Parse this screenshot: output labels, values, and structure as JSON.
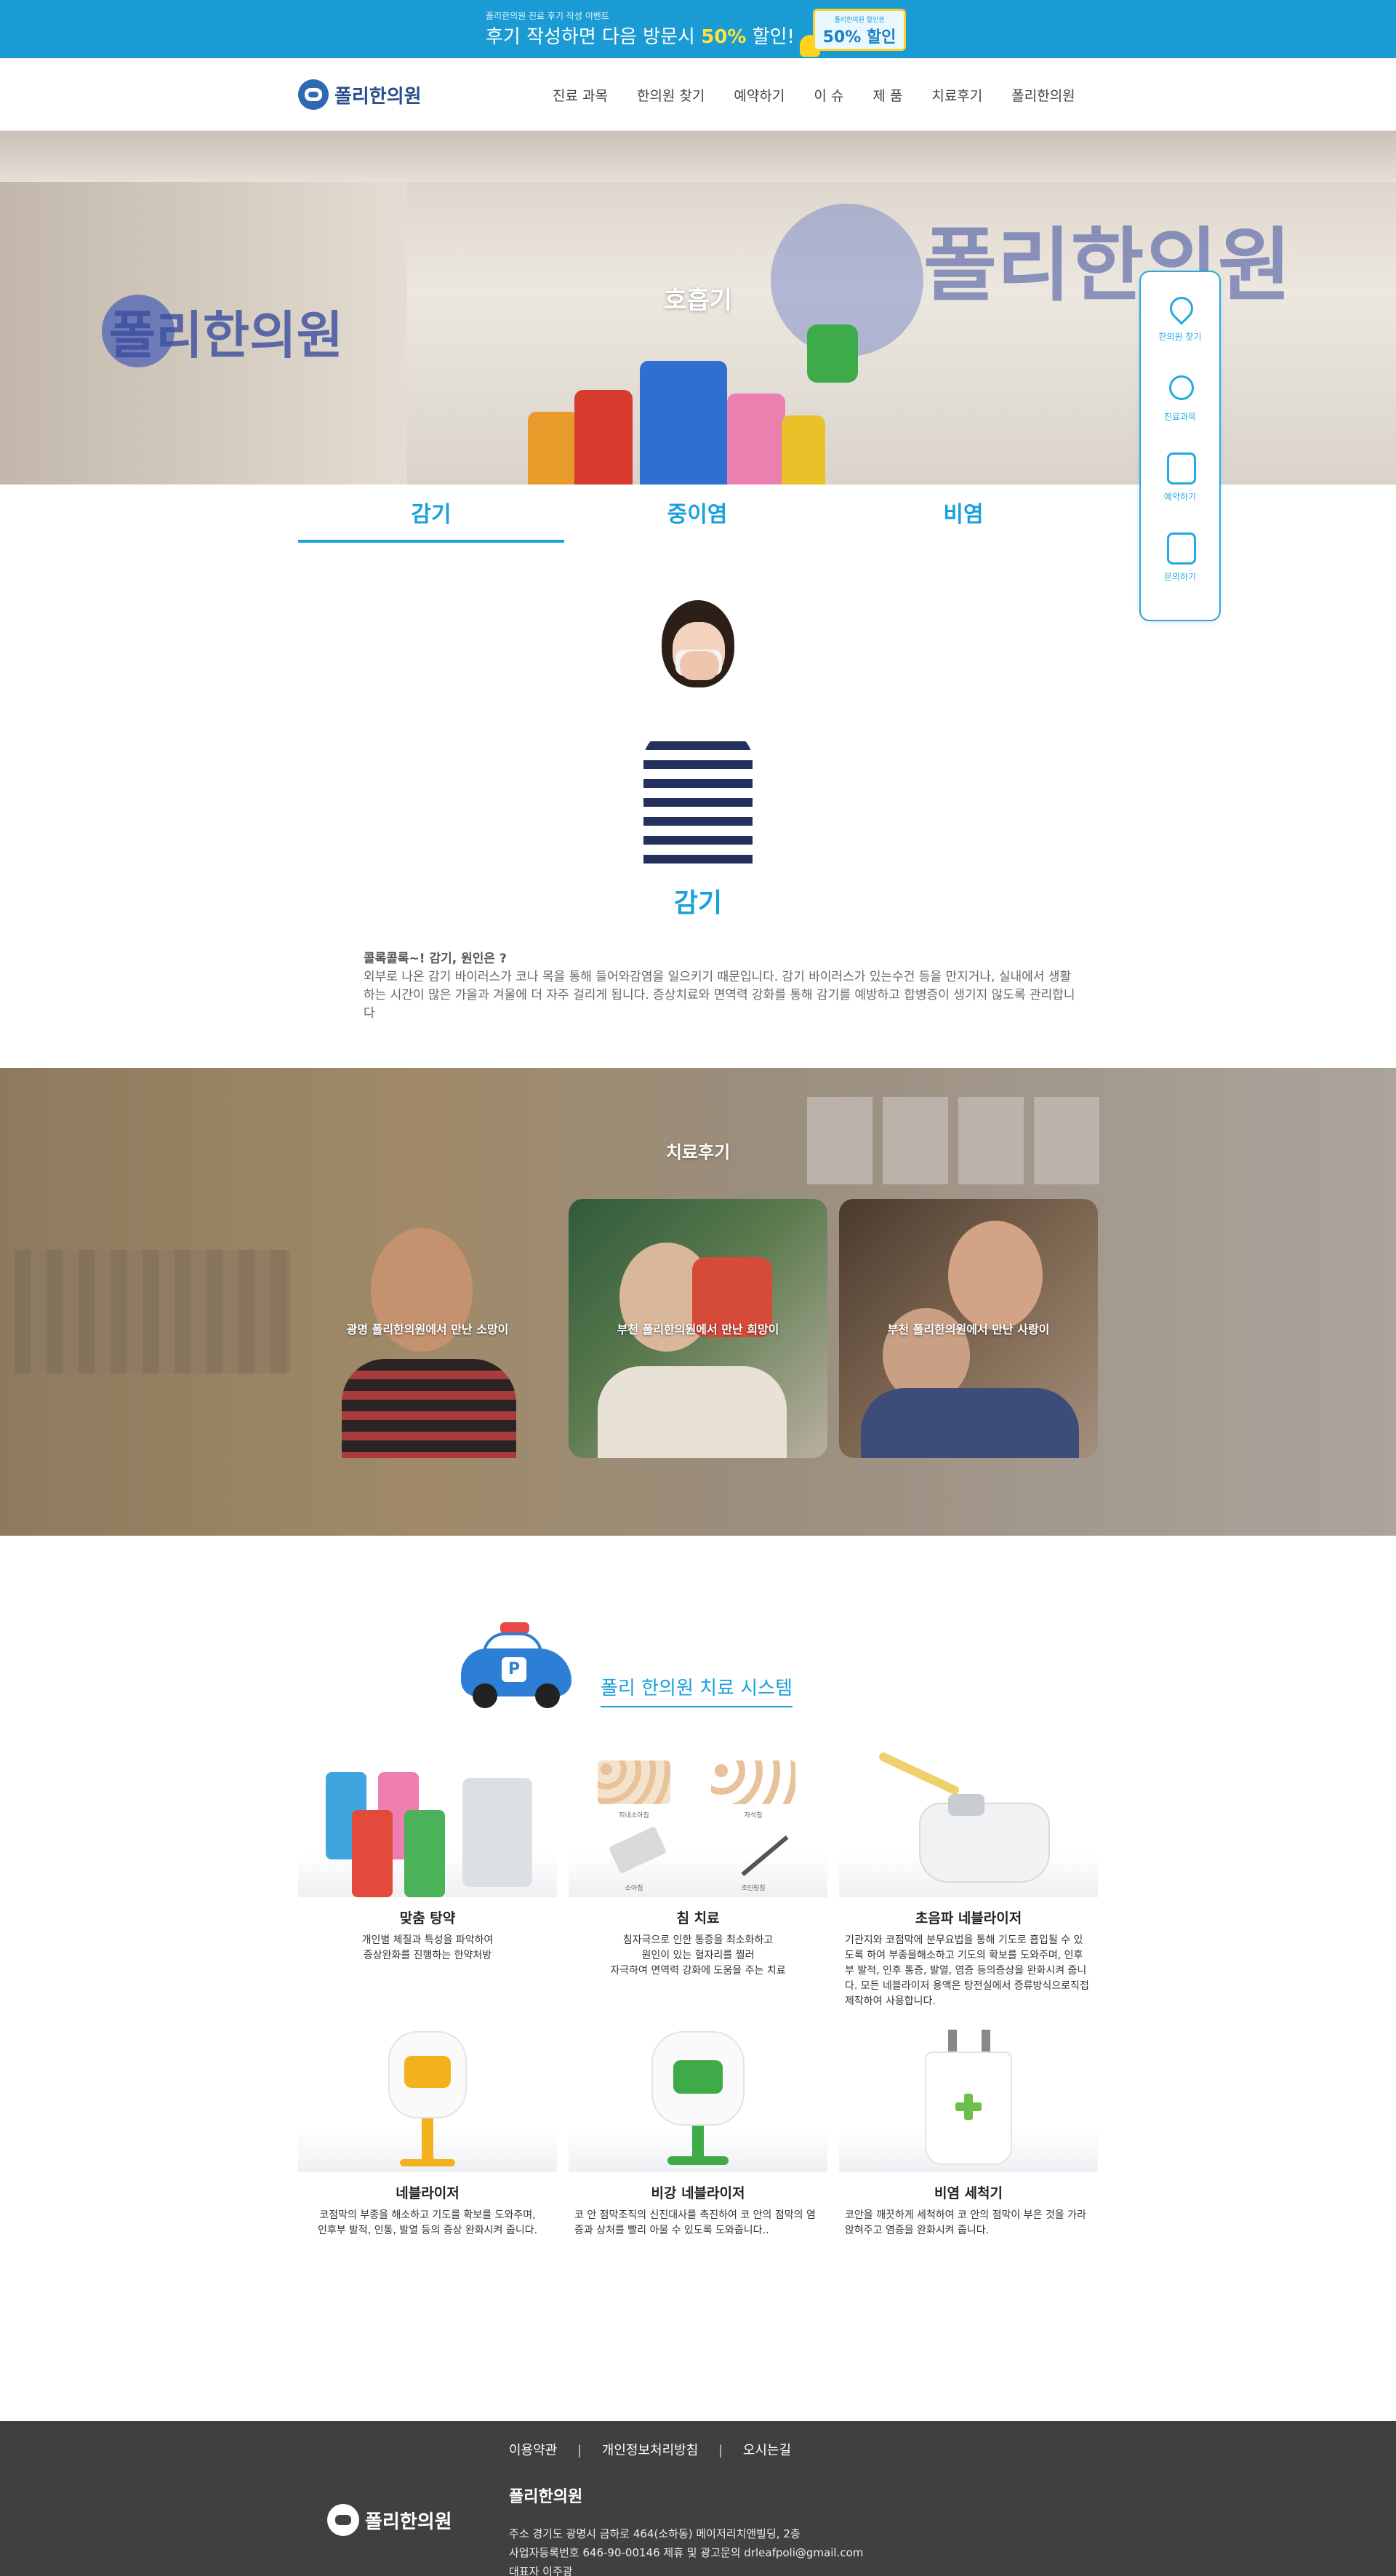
{
  "promo": {
    "small": "폴리한의원 진료 후기 작성 이벤트",
    "big_pre": "후기 작성하면 다음 방문시 ",
    "big_pct": "50%",
    "big_post": " 할인!",
    "coupon_sub": "폴리한의원 할인권",
    "coupon_main": "50% 할인"
  },
  "header": {
    "logo": "폴리한의원",
    "nav": [
      "진료 과목",
      "한의원 찾기",
      "예약하기",
      "이 슈",
      "제 품",
      "치료후기",
      "폴리한의원"
    ]
  },
  "hero": {
    "title": "호흡기",
    "sign1": "폴리한의원",
    "sign2": "폴리한의원"
  },
  "quick_menu": [
    {
      "label": "한의원 찾기",
      "icon": "location-pin-icon"
    },
    {
      "label": "진료과목",
      "icon": "stethoscope-icon"
    },
    {
      "label": "예약하기",
      "icon": "calendar-check-icon"
    },
    {
      "label": "문의하기",
      "icon": "calendar-chat-icon"
    }
  ],
  "tabs": [
    "감기",
    "중이염",
    "비염"
  ],
  "disease": {
    "title": "감기",
    "heading": "콜록콜록~! 감기, 원인은 ?",
    "body": "외부로 나온 감기 바이러스가 코나 목을 통해 들어와감염을 일으키기 때문입니다. 감기 바이러스가 있는수건 등을 만지거나, 실내에서 생활하는 시간이 많은 가을과 겨울에 더 자주 걸리게 됩니다. 증상치료와 면역력 강화를 통해 감기를 예방하고 합병증이 생기지 않도록 관리합니다"
  },
  "review": {
    "title": "치료후기",
    "cards": [
      "광명 폴리한의원에서 만난 소망이",
      "부천 폴리한의원에서 만난 희망이",
      "부천 폴리한의원에서 만난 사랑이"
    ]
  },
  "system": {
    "title": "폴리 한의원 치료 시스템",
    "products": [
      {
        "name": "맞춤 탕약",
        "desc": "개인별 체질과 특성을 파악하여\n증상완화를 진행하는 한약처방",
        "align": "center"
      },
      {
        "name": "침 치료",
        "desc": "침자극으로 인한 통증을 최소화하고\n원인이 있는 혈자리를 찔러\n자극하여 면역력 강화에 도움을 주는 치료",
        "align": "center",
        "img_labels": [
          "피내소아침",
          "자석침",
          "소아침",
          "조인링침"
        ]
      },
      {
        "name": "초음파 네블라이저",
        "desc": "기관지와 코점막에 분무요법을 통해 기도로 흡입될 수 있도록 하여 부종을해소하고 기도의 확보를 도와주며, 인후부 발적, 인후 통증, 발열, 염증 등의증상을 완화시켜 줍니다. 모든 네블라이저 용액은 탕전실에서 증류방식으로직접 제작하여 사용합니다.",
        "align": "left"
      },
      {
        "name": "네블라이저",
        "desc": "코점막의 부종을 해소하고 기도를 확보를 도와주며,\n인후부 발적, 인통, 발열 등의 증상 완화시켜 줍니다.",
        "align": "center"
      },
      {
        "name": "비강 네블라이저",
        "desc": "코 안 점막조직의 신진대사를 촉진하여 코 안의 점막의 염증과 상처를 빨리 아물 수 있도록 도와줍니다..",
        "align": "left"
      },
      {
        "name": "비염 세척기",
        "desc": "코안을 깨끗하게 세척하여 코 안의 점막이 부은 것을 가라앉혀주고 염증을 완화시켜 줍니다.",
        "align": "left"
      }
    ]
  },
  "footer": {
    "links": [
      "이용약관",
      "개인정보처리방침",
      "오시는길"
    ],
    "sep": "|",
    "logo": "폴리한의원",
    "name": "폴리한의원",
    "address": "주소 경기도 광명시 금하로 464(소하동) 메이저리치앤빌딩, 2층",
    "biz": "사업자등록번호 646-90-00146   제휴 및 광고문의 drleafpoli@gmail.com",
    "ceo": "대표자 이주광"
  },
  "colors": {
    "accent": "#1aa0db",
    "promo_bg": "#1a9bd3",
    "footer_bg": "#404040",
    "highlight": "#ffe23b"
  }
}
